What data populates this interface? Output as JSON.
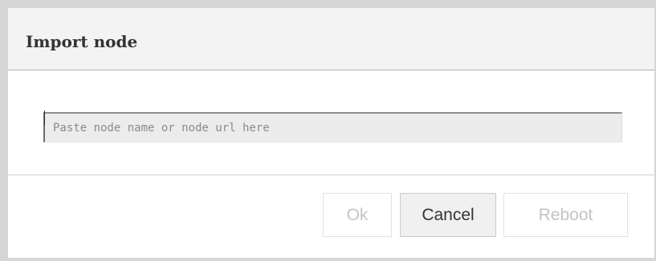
{
  "dialog": {
    "title": "Import node",
    "input": {
      "placeholder": "Paste node name or node url here",
      "value": ""
    },
    "buttons": {
      "ok_label": "Ok",
      "cancel_label": "Cancel",
      "reboot_label": "Reboot"
    }
  }
}
